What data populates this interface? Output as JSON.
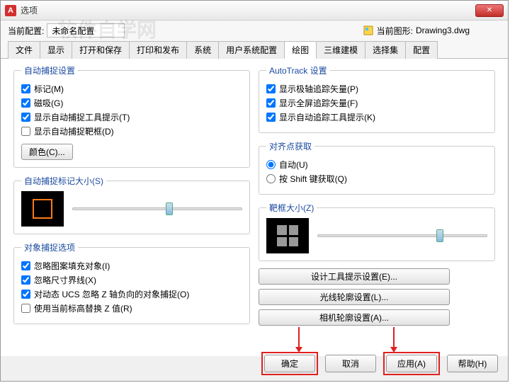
{
  "window": {
    "title": "选项"
  },
  "toprow": {
    "current_profile_label": "当前配置:",
    "current_profile_value": "未命名配置",
    "current_drawing_label": "当前图形:",
    "current_drawing_value": "Drawing3.dwg"
  },
  "tabs": [
    "文件",
    "显示",
    "打开和保存",
    "打印和发布",
    "系统",
    "用户系统配置",
    "绘图",
    "三维建模",
    "选择集",
    "配置"
  ],
  "active_tab": "绘图",
  "autosnap": {
    "legend": "自动捕捉设置",
    "marker": "标记(M)",
    "magnet": "磁吸(G)",
    "tooltip": "显示自动捕捉工具提示(T)",
    "aperture": "显示自动捕捉靶框(D)",
    "colors_btn": "颜色(C)..."
  },
  "marker_size": {
    "legend": "自动捕捉标记大小(S)"
  },
  "osnap_opts": {
    "legend": "对象捕捉选项",
    "hatch": "忽略图案填充对象(I)",
    "dim": "忽略尺寸界线(X)",
    "ucs": "对动态 UCS 忽略 Z 轴负向的对象捕捉(O)",
    "zreplace": "使用当前标高替换 Z 值(R)"
  },
  "autotrack": {
    "legend": "AutoTrack 设置",
    "polar": "显示极轴追踪矢量(P)",
    "full": "显示全屏追踪矢量(F)",
    "tooltip": "显示自动追踪工具提示(K)"
  },
  "align": {
    "legend": "对齐点获取",
    "auto": "自动(U)",
    "shift": "按 Shift 键获取(Q)"
  },
  "aperture_size": {
    "legend": "靶框大小(Z)"
  },
  "buttons_right": {
    "design": "设计工具提示设置(E)...",
    "light": "光线轮廓设置(L)...",
    "camera": "相机轮廓设置(A)..."
  },
  "footer": {
    "ok": "确定",
    "cancel": "取消",
    "apply": "应用(A)",
    "help": "帮助(H)"
  }
}
